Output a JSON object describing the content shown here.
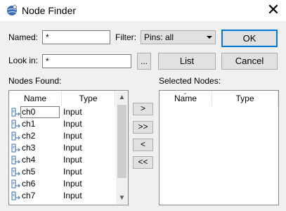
{
  "window": {
    "title": "Node Finder",
    "close_icon": "close-icon"
  },
  "form": {
    "named_label": "Named:",
    "named_value": "*",
    "filter_label": "Filter:",
    "filter_value": "Pins: all",
    "look_in_label": "Look in:",
    "look_in_value": "*",
    "browse_label": "...",
    "list_label": "List",
    "ok_label": "OK",
    "cancel_label": "Cancel"
  },
  "nodes_found": {
    "label": "Nodes Found:",
    "columns": [
      "Name",
      "Type"
    ],
    "rows": [
      {
        "name": "ch0",
        "type": "Input"
      },
      {
        "name": "ch1",
        "type": "Input"
      },
      {
        "name": "ch2",
        "type": "Input"
      },
      {
        "name": "ch3",
        "type": "Input"
      },
      {
        "name": "ch4",
        "type": "Input"
      },
      {
        "name": "ch5",
        "type": "Input"
      },
      {
        "name": "ch6",
        "type": "Input"
      },
      {
        "name": "ch7",
        "type": "Input"
      }
    ]
  },
  "transfer": {
    "add": ">",
    "add_all": ">>",
    "remove": "<",
    "remove_all": "<<"
  },
  "selected_nodes": {
    "label": "Selected Nodes:",
    "columns": [
      "Name",
      "Type"
    ]
  }
}
